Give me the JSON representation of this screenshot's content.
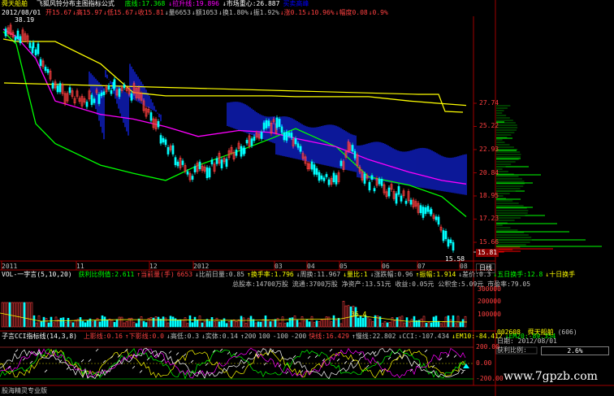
{
  "header": {
    "stock_name": "舜天船舶",
    "formula_name": "飞狐风铃分布主图指标公式",
    "ma_items": [
      {
        "text": "底线:17.368",
        "color": "#00ff00"
      },
      {
        "text": "↓拉升线:19.896",
        "color": "#ff00ff"
      },
      {
        "text": "↓市场重心:26.887",
        "color": "#ffffff"
      },
      {
        "text": "买卖高峰",
        "color": "#0000ff"
      }
    ]
  },
  "info_line": {
    "date": "2012/08/01",
    "items": [
      {
        "text": "开15.67",
        "color": "#ff4040"
      },
      {
        "text": "↓高15.97",
        "color": "#ff4040"
      },
      {
        "text": "↓低15.67",
        "color": "#ff4040"
      },
      {
        "text": "↓收15.81",
        "color": "#ff4040"
      },
      {
        "text": "↓量6653",
        "color": "#c0c0c0"
      },
      {
        "text": "↓额1053",
        "color": "#c0c0c0"
      },
      {
        "text": "↓换1.80%",
        "color": "#c0c0c0"
      },
      {
        "text": "↓振1.92%",
        "color": "#c0c0c0"
      },
      {
        "text": "↓涨0.15",
        "color": "#ff4040"
      },
      {
        "text": "↓10.96%",
        "color": "#ff4040"
      },
      {
        "text": "↓幅度0.08",
        "color": "#ff4040"
      },
      {
        "text": "↓0.9%",
        "color": "#ff4040"
      }
    ]
  },
  "main_chart": {
    "high_label": "38.19",
    "low_label": "15.58",
    "current_price": "15.81",
    "price_ticks": [
      "27.74",
      "25.22",
      "22.93",
      "20.84",
      "18.95",
      "17.23",
      "15.66"
    ],
    "time_ticks": [
      "2011",
      "11",
      "12",
      "2012",
      "03",
      "04",
      "05",
      "06",
      "07",
      "08"
    ],
    "tab_label": "日线"
  },
  "sub_chart1": {
    "name": "VOL-一字言(5,10,20)",
    "stats": [
      {
        "text": "获利比例值:2.611",
        "color": "#00ff00"
      },
      {
        "text": "↑当前量(手)",
        "color": "#ff4040"
      },
      {
        "text": "6653",
        "color": "#ff4040"
      },
      {
        "text": "↓比前日量:0.85",
        "color": "#c0c0c0"
      },
      {
        "text": "↑换手率:1.796",
        "color": "#ffff00"
      },
      {
        "text": "↓周换:11.967",
        "color": "#c0c0c0"
      },
      {
        "text": "↓量比:1",
        "color": "#ffff00"
      },
      {
        "text": "↓涨跌幅:0.96",
        "color": "#c0c0c0"
      },
      {
        "text": "↑振幅:1.914",
        "color": "#ffff00"
      },
      {
        "text": "↓差价:0.3",
        "color": "#c0c0c0"
      },
      {
        "text": "↓五日换手:12.8",
        "color": "#00ff00"
      },
      {
        "text": "↓十日换手",
        "color": "#ffff00"
      }
    ],
    "info2": "总股本:14700万股  流通:3700万股  净资产:13.51元  收益:0.05元  公积金:5.09元  市盈率:79.05",
    "vol_ticks": [
      "300000",
      "200000",
      "100000"
    ],
    "vol_annotation": "36.4"
  },
  "sub_chart2": {
    "name": "子言CCI指标线(14,3,8)",
    "stats": [
      {
        "text": "上影线:0.16",
        "color": "#ff4040"
      },
      {
        "text": "↑下影线:0.0",
        "color": "#ff4040"
      },
      {
        "text": "↓高低:0.3",
        "color": "#c0c0c0"
      },
      {
        "text": "↓实体:0.14",
        "color": "#c0c0c0"
      },
      {
        "text": "↑200",
        "color": "#c0c0c0"
      },
      {
        "text": "100",
        "color": "#c0c0c0"
      },
      {
        "text": "-100",
        "color": "#c0c0c0"
      },
      {
        "text": "-200",
        "color": "#c0c0c0"
      },
      {
        "text": "快线:16.429",
        "color": "#ff4040"
      },
      {
        "text": "↑慢线:22.802",
        "color": "#c0c0c0"
      },
      {
        "text": "↓CCI:-107.434",
        "color": "#c0c0c0"
      },
      {
        "text": "↓EM10:-84.412",
        "color": "#ffff00"
      },
      {
        "text": "↓EM20:-89.354",
        "color": "#00ff00"
      }
    ],
    "cci_ticks": [
      "200.00",
      "0.00",
      "-200.00"
    ]
  },
  "right_panel": {
    "stock_code": "002608",
    "stock_name": "舜天船舶",
    "code_extra": "(606)",
    "date_label": "日期:",
    "date": "2012/08/01",
    "profit_label": "获利比例:",
    "profit_value": "2.6%"
  },
  "footer": {
    "software": "股海精灵专业版",
    "watermark": "www.7gpzb.com"
  },
  "chart_data": {
    "type": "line",
    "title": "",
    "ylim": [
      15.0,
      30.0
    ],
    "series": [
      {
        "name": "底线",
        "values": [
          36.5,
          34.0,
          25.5,
          23.5,
          21.5,
          20.8,
          20.2,
          21.5,
          22.8,
          24.0,
          25.0,
          23.2,
          20.5,
          19.8,
          18.9,
          17.4
        ]
      },
      {
        "name": "拉升线",
        "values": [
          37.0,
          35.5,
          31.0,
          28.0,
          26.5,
          26.0,
          25.2,
          24.2,
          24.8,
          24.6,
          24.0,
          23.2,
          22.0,
          20.9,
          20.2,
          19.9
        ]
      },
      {
        "name": "市场重心",
        "values": [
          35.0,
          34.5,
          34.5,
          34.5,
          29.9,
          29.0,
          28.6,
          28.6,
          28.6,
          28.6,
          28.5,
          28.5,
          28.5,
          28.0,
          27.7,
          27.5
        ]
      }
    ],
    "x": [
      0,
      16,
      40,
      64,
      120,
      160,
      200,
      240,
      290,
      330,
      360,
      410,
      450,
      500,
      540,
      570
    ],
    "yticks": [
      27.74,
      25.22,
      22.93,
      20.84,
      18.95,
      17.23,
      15.66
    ]
  }
}
